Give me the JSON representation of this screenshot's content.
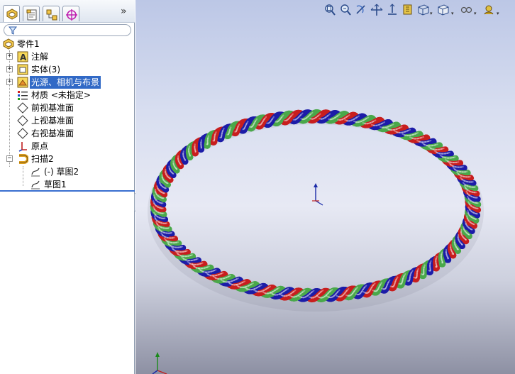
{
  "feature_tree": {
    "root": "零件1",
    "items": [
      {
        "label": "注解",
        "icon": "annotations-icon",
        "expandable": true
      },
      {
        "label": "实体(3)",
        "icon": "solid-bodies-icon",
        "expandable": true
      },
      {
        "label": "光源、相机与布景",
        "icon": "lights-cameras-scene-icon",
        "expandable": true,
        "selected": true
      },
      {
        "label": "材质 <未指定>",
        "icon": "material-icon",
        "expandable": false
      },
      {
        "label": "前视基准面",
        "icon": "plane-icon",
        "expandable": false
      },
      {
        "label": "上视基准面",
        "icon": "plane-icon",
        "expandable": false
      },
      {
        "label": "右视基准面",
        "icon": "plane-icon",
        "expandable": false
      },
      {
        "label": "原点",
        "icon": "origin-icon",
        "expandable": false
      },
      {
        "label": "扫描2",
        "icon": "sweep-icon",
        "expandable": true,
        "expanded": true
      },
      {
        "label": "(-) 草图2",
        "icon": "sketch-icon",
        "child": true
      },
      {
        "label": "草图1",
        "icon": "sketch-icon",
        "child": true
      }
    ]
  },
  "panel_tabs": [
    "feature-manager-tab",
    "property-manager-tab",
    "configuration-manager-tab",
    "dimxpert-manager-tab"
  ],
  "colors": {
    "selection": "#3169c6",
    "strand_red": "#c81e1e",
    "strand_green": "#4aa84a",
    "strand_blue": "#1c1ca8"
  }
}
